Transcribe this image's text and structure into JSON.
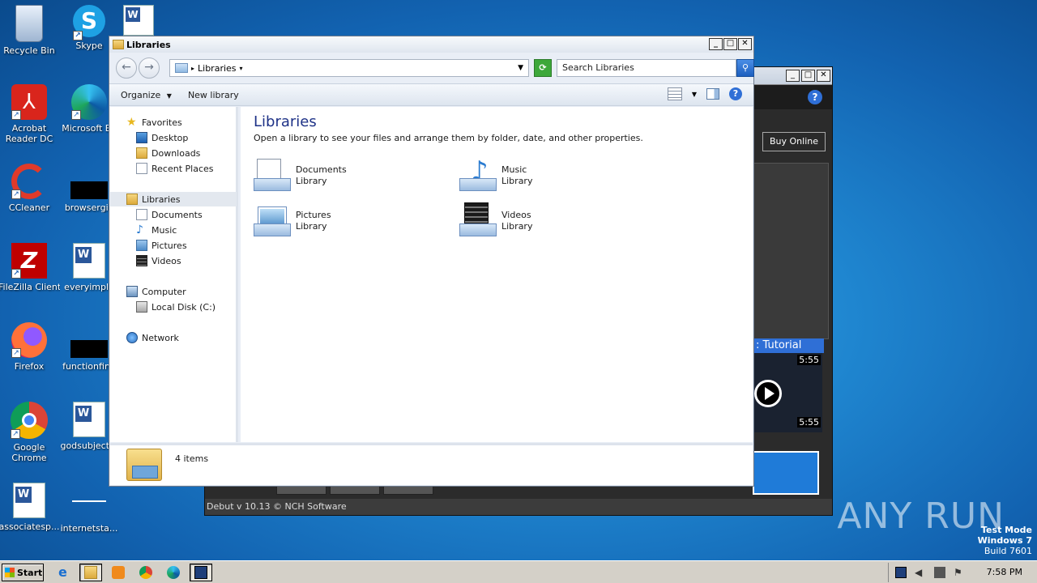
{
  "desktop": {
    "icons": [
      {
        "label": "Recycle Bin"
      },
      {
        "label": "Skype"
      },
      {
        "label": "Acrobat Reader DC"
      },
      {
        "label": "Microsoft Ed"
      },
      {
        "label": "CCleaner"
      },
      {
        "label": "browsergiv"
      },
      {
        "label": "FileZilla Client"
      },
      {
        "label": "everyimple"
      },
      {
        "label": "Firefox"
      },
      {
        "label": "functionfind"
      },
      {
        "label": "Google Chrome"
      },
      {
        "label": "godsubject..."
      },
      {
        "label": "associatesp..."
      },
      {
        "label": "internetsta..."
      }
    ]
  },
  "debut": {
    "buy_label": "Buy Online",
    "tutorial_label": ": Tutorial",
    "duration_top": "5:55",
    "duration_bottom": "5:55",
    "status": "Debut v 10.13 © NCH Software"
  },
  "explorer": {
    "title": "Libraries",
    "address": "Libraries",
    "search_placeholder": "Search Libraries",
    "toolbar": {
      "organize": "Organize",
      "new_library": "New library"
    },
    "nav": {
      "favorites": "Favorites",
      "desktop": "Desktop",
      "downloads": "Downloads",
      "recent": "Recent Places",
      "libraries": "Libraries",
      "documents": "Documents",
      "music": "Music",
      "pictures": "Pictures",
      "videos": "Videos",
      "computer": "Computer",
      "local_disk": "Local Disk (C:)",
      "network": "Network"
    },
    "heading": "Libraries",
    "subheading": "Open a library to see your files and arrange them by folder, date, and other properties.",
    "libraries": [
      {
        "name": "Documents",
        "type": "Library"
      },
      {
        "name": "Music",
        "type": "Library"
      },
      {
        "name": "Pictures",
        "type": "Library"
      },
      {
        "name": "Videos",
        "type": "Library"
      }
    ],
    "status_count": "4 items"
  },
  "watermark": "ANY RUN",
  "testmode": {
    "line1": "Test Mode",
    "line2": "Windows 7",
    "line3": "Build 7601"
  },
  "taskbar": {
    "start": "Start",
    "clock": "7:58 PM"
  }
}
